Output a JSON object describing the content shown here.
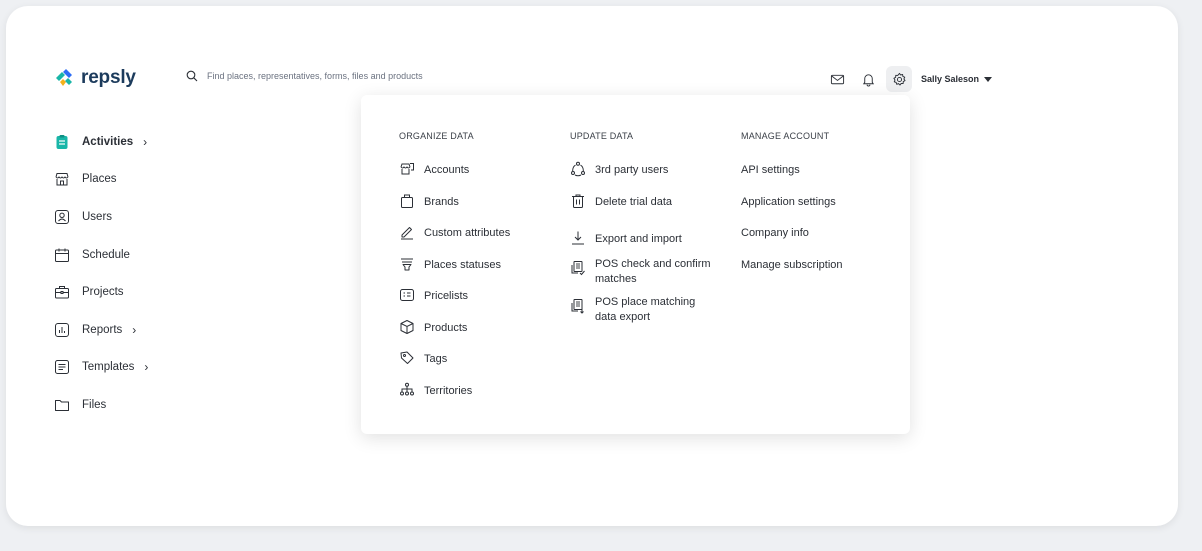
{
  "colors": {
    "brand_teal": "#19b6a8",
    "brand_blue": "#2d6df6",
    "brand_yellow": "#f5b21b",
    "text": "#2b2f36"
  },
  "header": {
    "logo_text": "repsly",
    "search": {
      "placeholder": "Find places, representatives, forms, files and products",
      "value": ""
    },
    "icons": [
      "mail-icon",
      "bell-icon",
      "gear-icon"
    ],
    "user_name": "Sally Saleson"
  },
  "sidebar": {
    "items": [
      {
        "label": "Activities",
        "icon": "activities-icon",
        "active": true,
        "has_arrow": true
      },
      {
        "label": "Places",
        "icon": "store-icon",
        "has_arrow": false
      },
      {
        "label": "Users",
        "icon": "user-icon",
        "has_arrow": false
      },
      {
        "label": "Schedule",
        "icon": "calendar-icon",
        "has_arrow": false
      },
      {
        "label": "Projects",
        "icon": "briefcase-icon",
        "has_arrow": false
      },
      {
        "label": "Reports",
        "icon": "chart-icon",
        "has_arrow": true
      },
      {
        "label": "Templates",
        "icon": "template-icon",
        "has_arrow": true
      },
      {
        "label": "Files",
        "icon": "folder-icon",
        "has_arrow": false
      }
    ],
    "arrow": "›"
  },
  "menu": {
    "organize": {
      "title": "ORGANIZE DATA",
      "items": [
        {
          "label": "Accounts",
          "icon": "accounts-icon"
        },
        {
          "label": "Brands",
          "icon": "bag-icon"
        },
        {
          "label": "Custom attributes",
          "icon": "pencil-icon"
        },
        {
          "label": "Places statuses",
          "icon": "filter-icon"
        },
        {
          "label": "Pricelists",
          "icon": "pricelist-icon"
        },
        {
          "label": "Products",
          "icon": "box-icon"
        },
        {
          "label": "Tags",
          "icon": "tag-icon"
        },
        {
          "label": "Territories",
          "icon": "hierarchy-icon"
        }
      ]
    },
    "update": {
      "title": "UPDATE DATA",
      "items": [
        {
          "label": "3rd party users",
          "icon": "users-cycle-icon"
        },
        {
          "label": "Delete trial data",
          "icon": "trash-icon"
        },
        {
          "label": "Export and import",
          "icon": "download-icon"
        },
        {
          "label": "POS check and confirm matches",
          "icon": "pos-check-icon"
        },
        {
          "label": "POS place matching data export",
          "icon": "pos-export-icon"
        }
      ]
    },
    "account": {
      "title": "MANAGE ACCOUNT",
      "items": [
        {
          "label": "API settings"
        },
        {
          "label": "Application settings"
        },
        {
          "label": "Company info"
        },
        {
          "label": "Manage subscription"
        }
      ]
    }
  }
}
